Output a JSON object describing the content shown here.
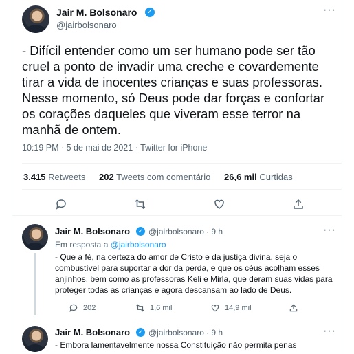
{
  "tweet": {
    "author_name": "Jair M. Bolsonaro",
    "handle": "@jairbolsonaro",
    "text": "- Difícil entender como um ser humano pode ser tão\ncruel a ponto de invadir uma creche e covardemente\ntirar a vida de inocentes crianças e suas professoras.\nNesse momento, só Deus pode dar forças e confortar\nos corações daqueles que viveram esse terror na\nmanhã de ontem.",
    "meta": "10:19 PM · 5 de mai de 2021 · Twitter for iPhone",
    "stats": {
      "retweets_count": "3.415",
      "retweets_label": "Retweets",
      "quotes_count": "202",
      "quotes_label": "Tweets com comentário",
      "likes_count": "26,6 mil",
      "likes_label": "Curtidas"
    }
  },
  "replies": [
    {
      "author_name": "Jair M. Bolsonaro",
      "handle": "@jairbolsonaro",
      "time": "· 9 h",
      "reply_prefix": "Em resposta a",
      "reply_handle": "@jairbolsonaro",
      "text": "- Que a fé, na certeza do amor de Cristo e da justiça divina, seja o combustível para suportar a dor da perda, e que os céus acolham esses anjinhos, bem como as professoras Keli e Mirla, que deram suas vidas para proteger todas as crianças e agora descansam ao lado de Deus.",
      "replies_count": "202",
      "retweets_count": "1,6 mil",
      "likes_count": "14,9 mil"
    },
    {
      "author_name": "Jair M. Bolsonaro",
      "handle": "@jairbolsonaro",
      "time": "· 9 h",
      "text": "- Embora lamentavelmente nossa Constituição não permita penas"
    }
  ],
  "colors": {
    "accent": "#1d9bf0",
    "muted": "#536471",
    "text": "#0f1419",
    "border": "#eff3f4"
  },
  "icons": [
    "verified-badge-icon",
    "more-icon",
    "reply-icon",
    "retweet-icon",
    "like-icon",
    "share-icon"
  ]
}
